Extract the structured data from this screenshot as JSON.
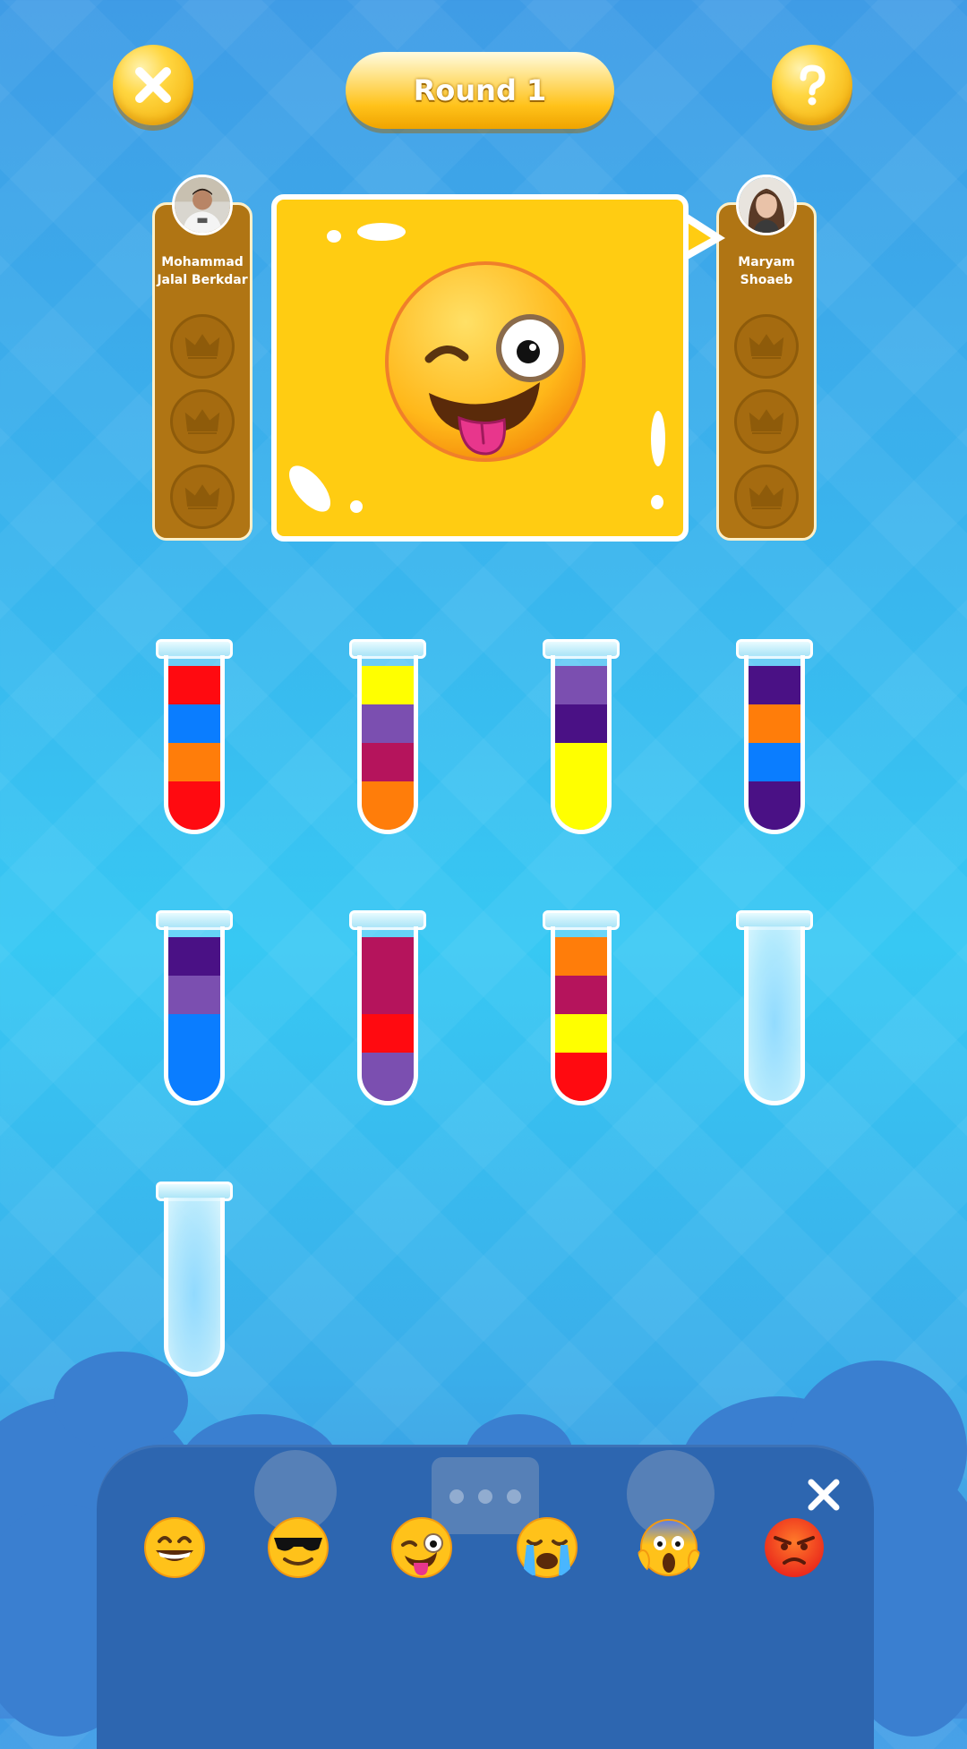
{
  "header": {
    "round_label": "Round 1",
    "close_icon": "close-icon",
    "help_icon": "question-icon"
  },
  "players": [
    {
      "name_line1": "Mohammad",
      "name_line2": "Jalal Berkdar",
      "crowns_won": 0,
      "crowns_total": 3
    },
    {
      "name_line1": "Maryam",
      "name_line2": "Shoaeb",
      "crowns_won": 0,
      "crowns_total": 3
    }
  ],
  "bubble": {
    "emoji": "winking-face-with-tongue"
  },
  "colors": {
    "red": "#ff0a10",
    "blue": "#0a7dff",
    "orange": "#ff7d0a",
    "yellow": "#ffff00",
    "violet": "#7b4fb0",
    "indigo": "#4a1185",
    "magenta": "#b5145c"
  },
  "tubes": [
    {
      "layers_top_to_bottom": [
        "red",
        "blue",
        "orange",
        "red"
      ]
    },
    {
      "layers_top_to_bottom": [
        "yellow",
        "violet",
        "magenta",
        "orange"
      ]
    },
    {
      "layers_top_to_bottom": [
        "violet",
        "indigo",
        "yellow",
        "yellow"
      ]
    },
    {
      "layers_top_to_bottom": [
        "indigo",
        "orange",
        "blue",
        "indigo"
      ]
    },
    {
      "layers_top_to_bottom": [
        "indigo",
        "violet",
        "blue",
        "blue"
      ]
    },
    {
      "layers_top_to_bottom": [
        "magenta",
        "magenta",
        "red",
        "violet"
      ]
    },
    {
      "layers_top_to_bottom": [
        "orange",
        "magenta",
        "yellow",
        "red"
      ]
    },
    {
      "layers_top_to_bottom": []
    },
    {
      "layers_top_to_bottom": []
    }
  ],
  "emoji_panel": {
    "close_icon": "close-icon",
    "emojis": [
      "grinning-face",
      "smiling-face-with-sunglasses",
      "winking-face-with-tongue",
      "loudly-crying-face",
      "face-screaming-in-fear",
      "angry-face"
    ],
    "background_buttons": [
      "undo-icon",
      "chat-icon",
      "flag-icon"
    ]
  }
}
